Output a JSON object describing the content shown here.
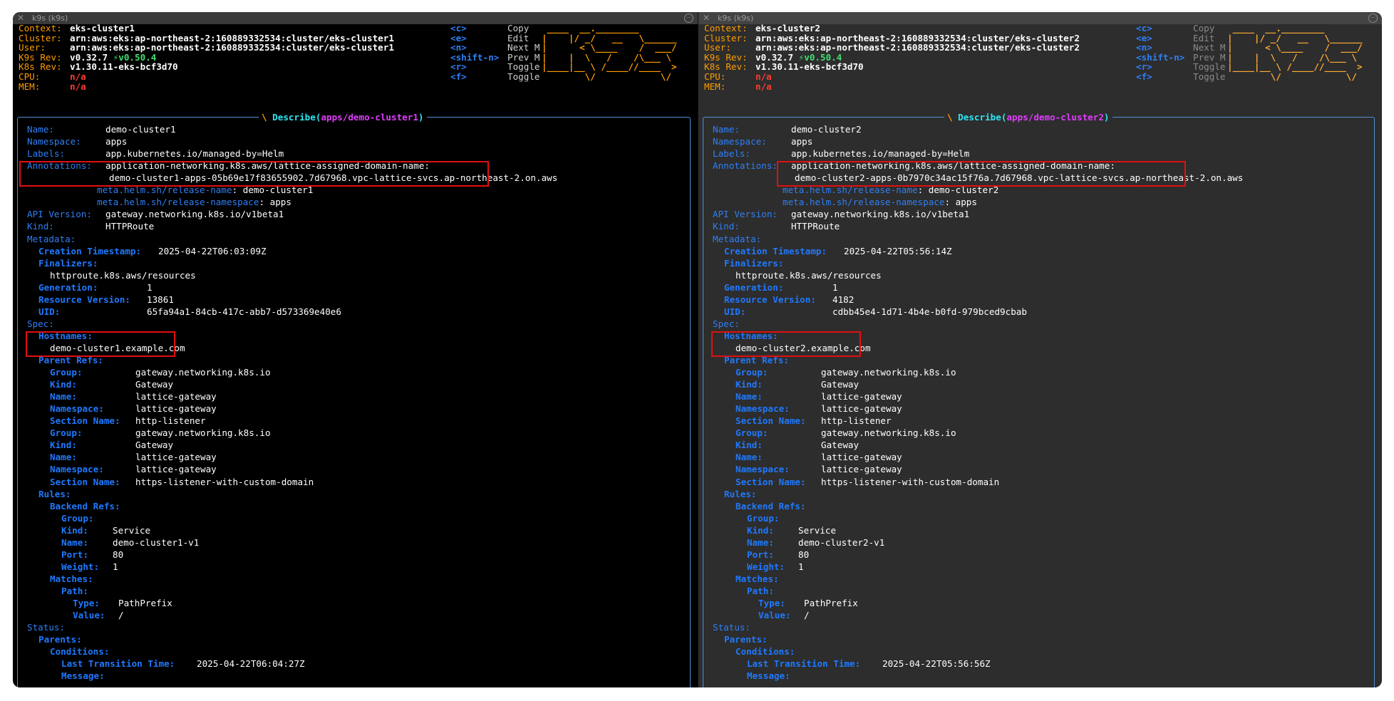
{
  "panes": {
    "left": {
      "window_title": "k9s (k9s)",
      "header": {
        "context_label": "Context:",
        "context": "eks-cluster1",
        "cluster_label": "Cluster:",
        "cluster": "arn:aws:eks:ap-northeast-2:160889332534:cluster/eks-cluster1",
        "user_label": "User:",
        "user": "arn:aws:eks:ap-northeast-2:160889332534:cluster/eks-cluster1",
        "k9s_rev_label": "K9s Rev:",
        "k9s_rev": "v0.32.7",
        "k9s_new": "⚡v0.50.4",
        "k8s_rev_label": "K8s Rev:",
        "k8s_rev": "v1.30.11-eks-bcf3d70",
        "cpu_label": "CPU:",
        "cpu": "n/a",
        "mem_label": "MEM:",
        "mem": "n/a"
      },
      "hotkeys": [
        {
          "key": "<c>",
          "desc": "Copy"
        },
        {
          "key": "<e>",
          "desc": "Edit"
        },
        {
          "key": "<n>",
          "desc": "Next M"
        },
        {
          "key": "<shift-n>",
          "desc": "Prev M"
        },
        {
          "key": "<r>",
          "desc": "Toggle"
        },
        {
          "key": "<f>",
          "desc": "Toggle"
        }
      ],
      "frame": {
        "prefix": "\\ ",
        "action": "Describe",
        "paren_open": "(",
        "path": "apps/demo-cluster1",
        "paren_close": ")"
      },
      "name": "demo-cluster1",
      "annotation_domain": "demo-cluster1-apps-05b69e17f83655902.7d67968.vpc-lattice-svcs.ap-northeast-2.on.aws",
      "release_name": "demo-cluster1",
      "creation_timestamp": "2025-04-22T06:03:09Z",
      "resource_version": "13861",
      "uid": "65fa94a1-84cb-417c-abb7-d573369e40e6",
      "hostname": "demo-cluster1.example.com",
      "backend_name": "demo-cluster1-v1",
      "last_transition_time": "2025-04-22T06:04:27Z"
    },
    "right": {
      "window_title": "k9s (k9s)",
      "header": {
        "context_label": "Context:",
        "context": "eks-cluster2",
        "cluster_label": "Cluster:",
        "cluster": "arn:aws:eks:ap-northeast-2:160889332534:cluster/eks-cluster2",
        "user_label": "User:",
        "user": "arn:aws:eks:ap-northeast-2:160889332534:cluster/eks-cluster2",
        "k9s_rev_label": "K9s Rev:",
        "k9s_rev": "v0.32.7",
        "k9s_new": "⚡v0.50.4",
        "k8s_rev_label": "K8s Rev:",
        "k8s_rev": "v1.30.11-eks-bcf3d70",
        "cpu_label": "CPU:",
        "cpu": "n/a",
        "mem_label": "MEM:",
        "mem": "n/a"
      },
      "hotkeys": [
        {
          "key": "<c>",
          "desc": "Copy"
        },
        {
          "key": "<e>",
          "desc": "Edit"
        },
        {
          "key": "<n>",
          "desc": "Next M"
        },
        {
          "key": "<shift-n>",
          "desc": "Prev M"
        },
        {
          "key": "<r>",
          "desc": "Toggle"
        },
        {
          "key": "<f>",
          "desc": "Toggle"
        }
      ],
      "frame": {
        "prefix": "\\ ",
        "action": "Describe",
        "paren_open": "(",
        "path": "apps/demo-cluster2",
        "paren_close": ")"
      },
      "name": "demo-cluster2",
      "annotation_domain": "demo-cluster2-apps-0b7970c34ac15f76a.7d67968.vpc-lattice-svcs.ap-northeast-2.on.aws",
      "release_name": "demo-cluster2",
      "creation_timestamp": "2025-04-22T05:56:14Z",
      "resource_version": "4182",
      "uid": "cdbb45e4-1d71-4b4e-b0fd-979bced9cbab",
      "hostname": "demo-cluster2.example.com",
      "backend_name": "demo-cluster2-v1",
      "last_transition_time": "2025-04-22T05:56:56Z"
    }
  },
  "logo_lines": [
    " ____  __.________        ",
    "|    |/ _/   __   \\______ ",
    "|      < \\____    /  ___/ ",
    "|    |  \\   /    /\\___ \\  ",
    "|____|__ \\ /____//____  > ",
    "        \\/            \\/  "
  ],
  "describe": {
    "name_label": "Name:",
    "namespace_label": "Namespace:",
    "namespace": "apps",
    "labels_label": "Labels:",
    "labels": "app.kubernetes.io/managed-by=Helm",
    "annotations_label": "Annotations:",
    "annotation_key": "application-networking.k8s.aws/lattice-assigned-domain-name:",
    "release_name_key": "meta.helm.sh/release-name",
    "release_ns_key": "meta.helm.sh/release-namespace",
    "release_ns": "apps",
    "api_version_label": "API Version:",
    "api_version": "gateway.networking.k8s.io/v1beta1",
    "kind_label": "Kind:",
    "kind": "HTTPRoute",
    "metadata_label": "Metadata:",
    "creation_label": "Creation Timestamp:",
    "finalizers_label": "Finalizers:",
    "finalizer": "httproute.k8s.aws/resources",
    "generation_label": "Generation:",
    "generation": "1",
    "resource_version_label": "Resource Version:",
    "uid_label": "UID:",
    "spec_label": "Spec:",
    "hostnames_label": "Hostnames:",
    "parent_refs_label": "Parent Refs:",
    "group_label": "Group:",
    "group": "gateway.networking.k8s.io",
    "kind_gw": "Gateway",
    "gw_name": "lattice-gateway",
    "gw_namespace": "lattice-gateway",
    "section_label": "Section Name:",
    "section1": "http-listener",
    "section2": "https-listener-with-custom-domain",
    "rules_label": "Rules:",
    "backend_refs_label": "Backend Refs:",
    "service_kind": "Service",
    "port_label": "Port:",
    "port": "80",
    "weight_label": "Weight:",
    "weight": "1",
    "matches_label": "Matches:",
    "path_label": "Path:",
    "type_label": "Type:",
    "type": "PathPrefix",
    "value_label": "Value:",
    "value": "/",
    "status_label": "Status:",
    "parents_label": "Parents:",
    "conditions_label": "Conditions:",
    "ltt_label": "Last Transition Time:",
    "message_label": "Message:"
  }
}
